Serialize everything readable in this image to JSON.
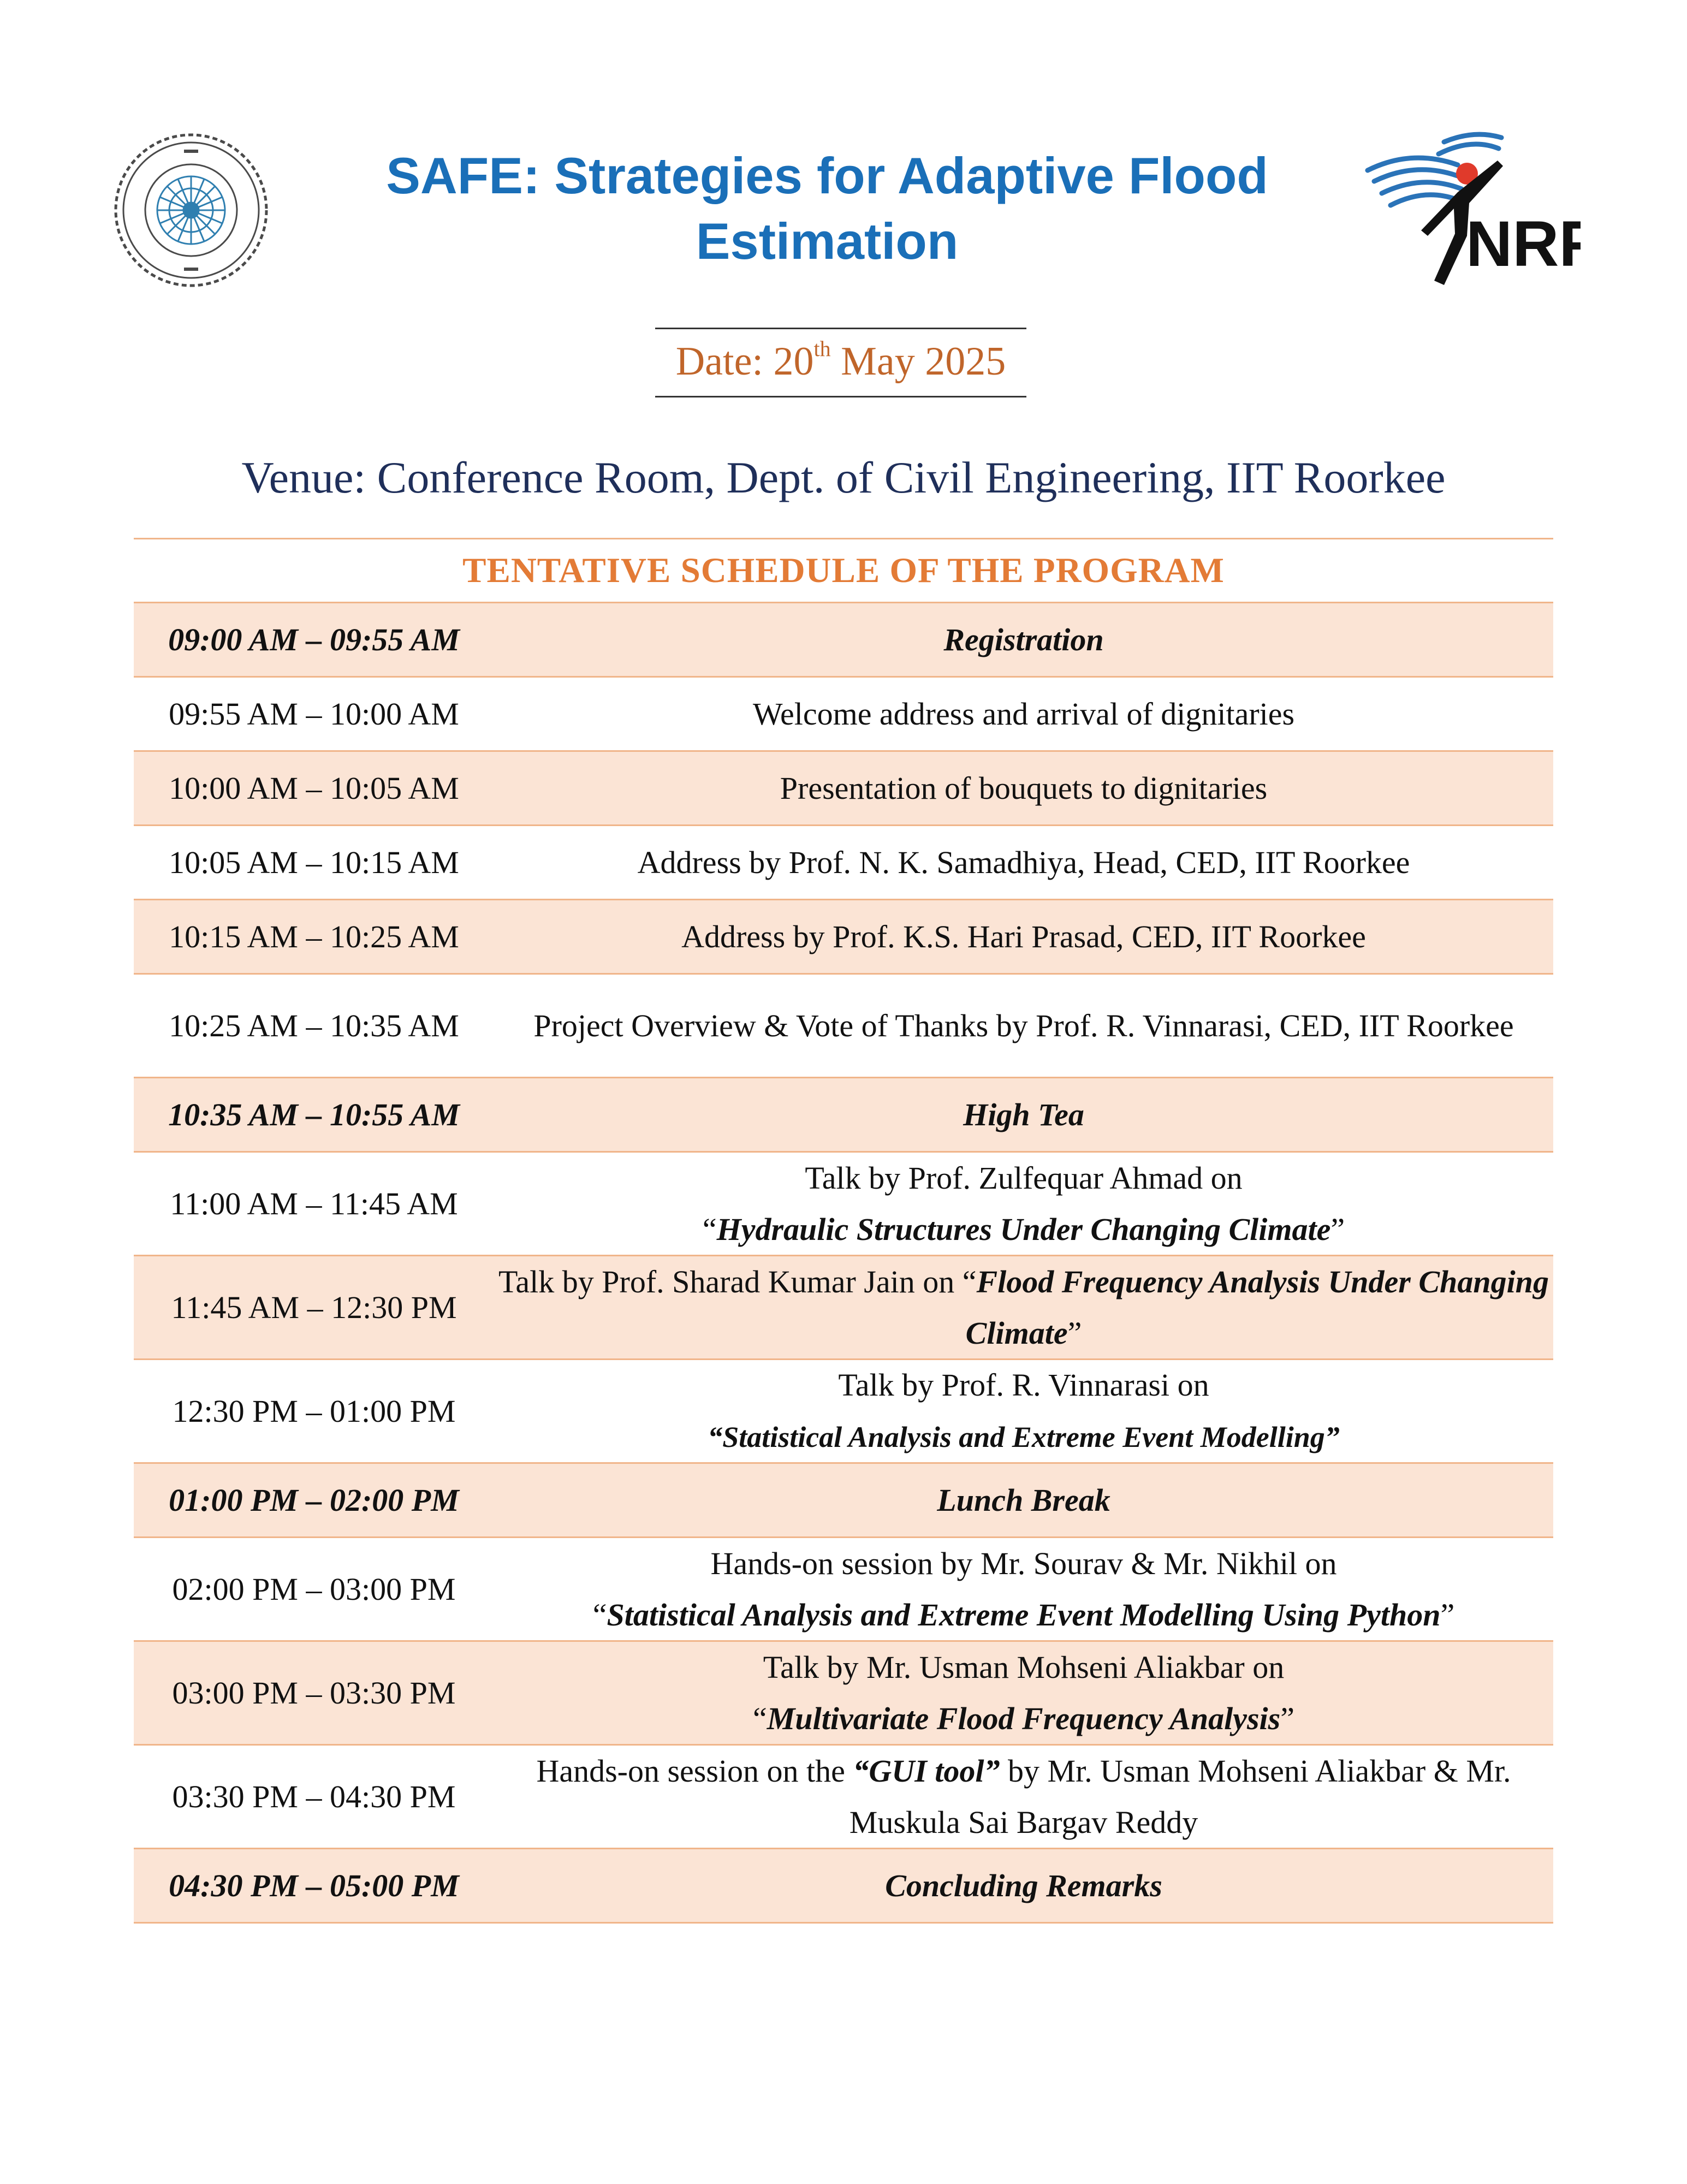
{
  "header": {
    "title": "SAFE: Strategies for Adaptive Flood Estimation",
    "date_prefix": "Date: 20",
    "date_sup": "th",
    "date_suffix": " May 2025",
    "venue": "Venue: Conference Room, Dept. of Civil Engineering, IIT Roorkee",
    "left_logo_icon": "iit-roorkee-seal-icon",
    "right_logo_icon": "nrf-logo-icon",
    "right_logo_text": "NRF"
  },
  "colors": {
    "title_blue": "#1a6fb8",
    "date_orange": "#c0652a",
    "venue_navy": "#1f2f5a",
    "heading_orange": "#e37b36",
    "row_shade": "#fbe4d5",
    "border": "#f0b58a"
  },
  "schedule": {
    "heading": "TENTATIVE SCHEDULE OF THE PROGRAM",
    "rows": [
      {
        "time": "09:00 AM – 09:55 AM",
        "event": "Registration"
      },
      {
        "time": "09:55 AM – 10:00 AM",
        "event": "Welcome address and arrival of dignitaries"
      },
      {
        "time": "10:00 AM – 10:05 AM",
        "event": "Presentation of bouquets to dignitaries"
      },
      {
        "time": "10:05 AM – 10:15 AM",
        "event": "Address by Prof. N. K. Samadhiya, Head, CED, IIT Roorkee"
      },
      {
        "time": "10:15 AM – 10:25 AM",
        "event": "Address by Prof. K.S. Hari Prasad, CED, IIT Roorkee"
      },
      {
        "time": "10:25 AM – 10:35 AM",
        "event": "Project Overview & Vote of Thanks by Prof. R. Vinnarasi, CED, IIT Roorkee"
      },
      {
        "time": "10:35 AM – 10:55 AM",
        "event": "High Tea"
      },
      {
        "time": "11:00 AM – 11:45 AM",
        "event_plain": "Talk by Prof. Zulfequar Ahmad on",
        "event_title": "Hydraulic Structures Under Changing Climate"
      },
      {
        "time": "11:45 AM – 12:30 PM",
        "event_plain": "Talk by Prof. Sharad Kumar Jain on ",
        "event_title": "Flood Frequency Analysis Under Changing Climate"
      },
      {
        "time": "12:30 PM – 01:00 PM",
        "event_plain": "Talk by Prof. R. Vinnarasi on",
        "event_title": "“Statistical Analysis and Extreme Event Modelling”"
      },
      {
        "time": "01:00 PM – 02:00 PM",
        "event": "Lunch Break"
      },
      {
        "time": "02:00 PM – 03:00 PM",
        "event_plain": "Hands-on session by Mr. Sourav & Mr. Nikhil on",
        "event_title": "Statistical Analysis and Extreme Event Modelling Using Python"
      },
      {
        "time": "03:00 PM – 03:30 PM",
        "event_plain": "Talk by Mr. Usman Mohseni Aliakbar on",
        "event_title": "Multivariate Flood Frequency Analysis"
      },
      {
        "time": "03:30 PM – 04:30 PM",
        "event_plain": "Hands-on session on the ",
        "event_title": "“GUI tool”",
        "event_after": " by Mr. Usman Mohseni Aliakbar & Mr. Muskula Sai Bargav Reddy"
      },
      {
        "time": "04:30 PM – 05:00 PM",
        "event": "Concluding Remarks"
      }
    ]
  }
}
